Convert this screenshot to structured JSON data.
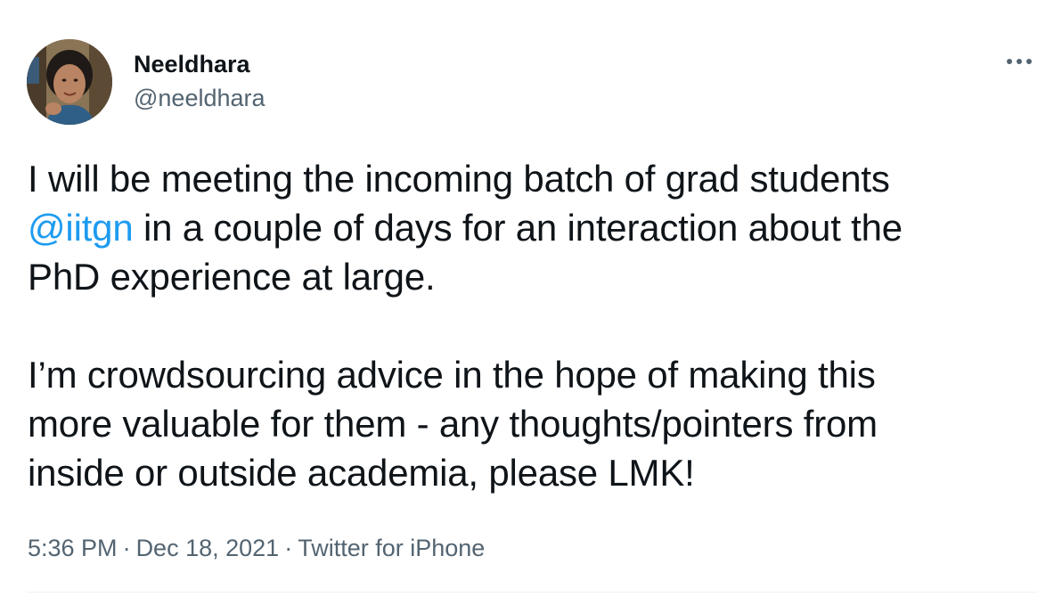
{
  "author": {
    "display_name": "Neeldhara",
    "handle": "@neeldhara"
  },
  "tweet": {
    "line1": "I will be meeting the incoming batch of grad students",
    "mention": "@iitgn",
    "line2_rest": " in a couple of days for an interaction about the",
    "line3": "PhD experience at large.",
    "para2_line1": "I’m crowdsourcing advice in the hope of making this",
    "para2_line2": "more valuable for them - any thoughts/pointers from",
    "para2_line3": "inside or outside academia, please LMK!"
  },
  "meta": {
    "time": "5:36 PM",
    "separator": "·",
    "date": "Dec 18, 2021",
    "source": "Twitter for iPhone"
  },
  "icons": {
    "more": "more-icon"
  },
  "colors": {
    "mention": "#1d9bf0",
    "secondary_text": "#536471",
    "primary_text": "#0f1419"
  }
}
